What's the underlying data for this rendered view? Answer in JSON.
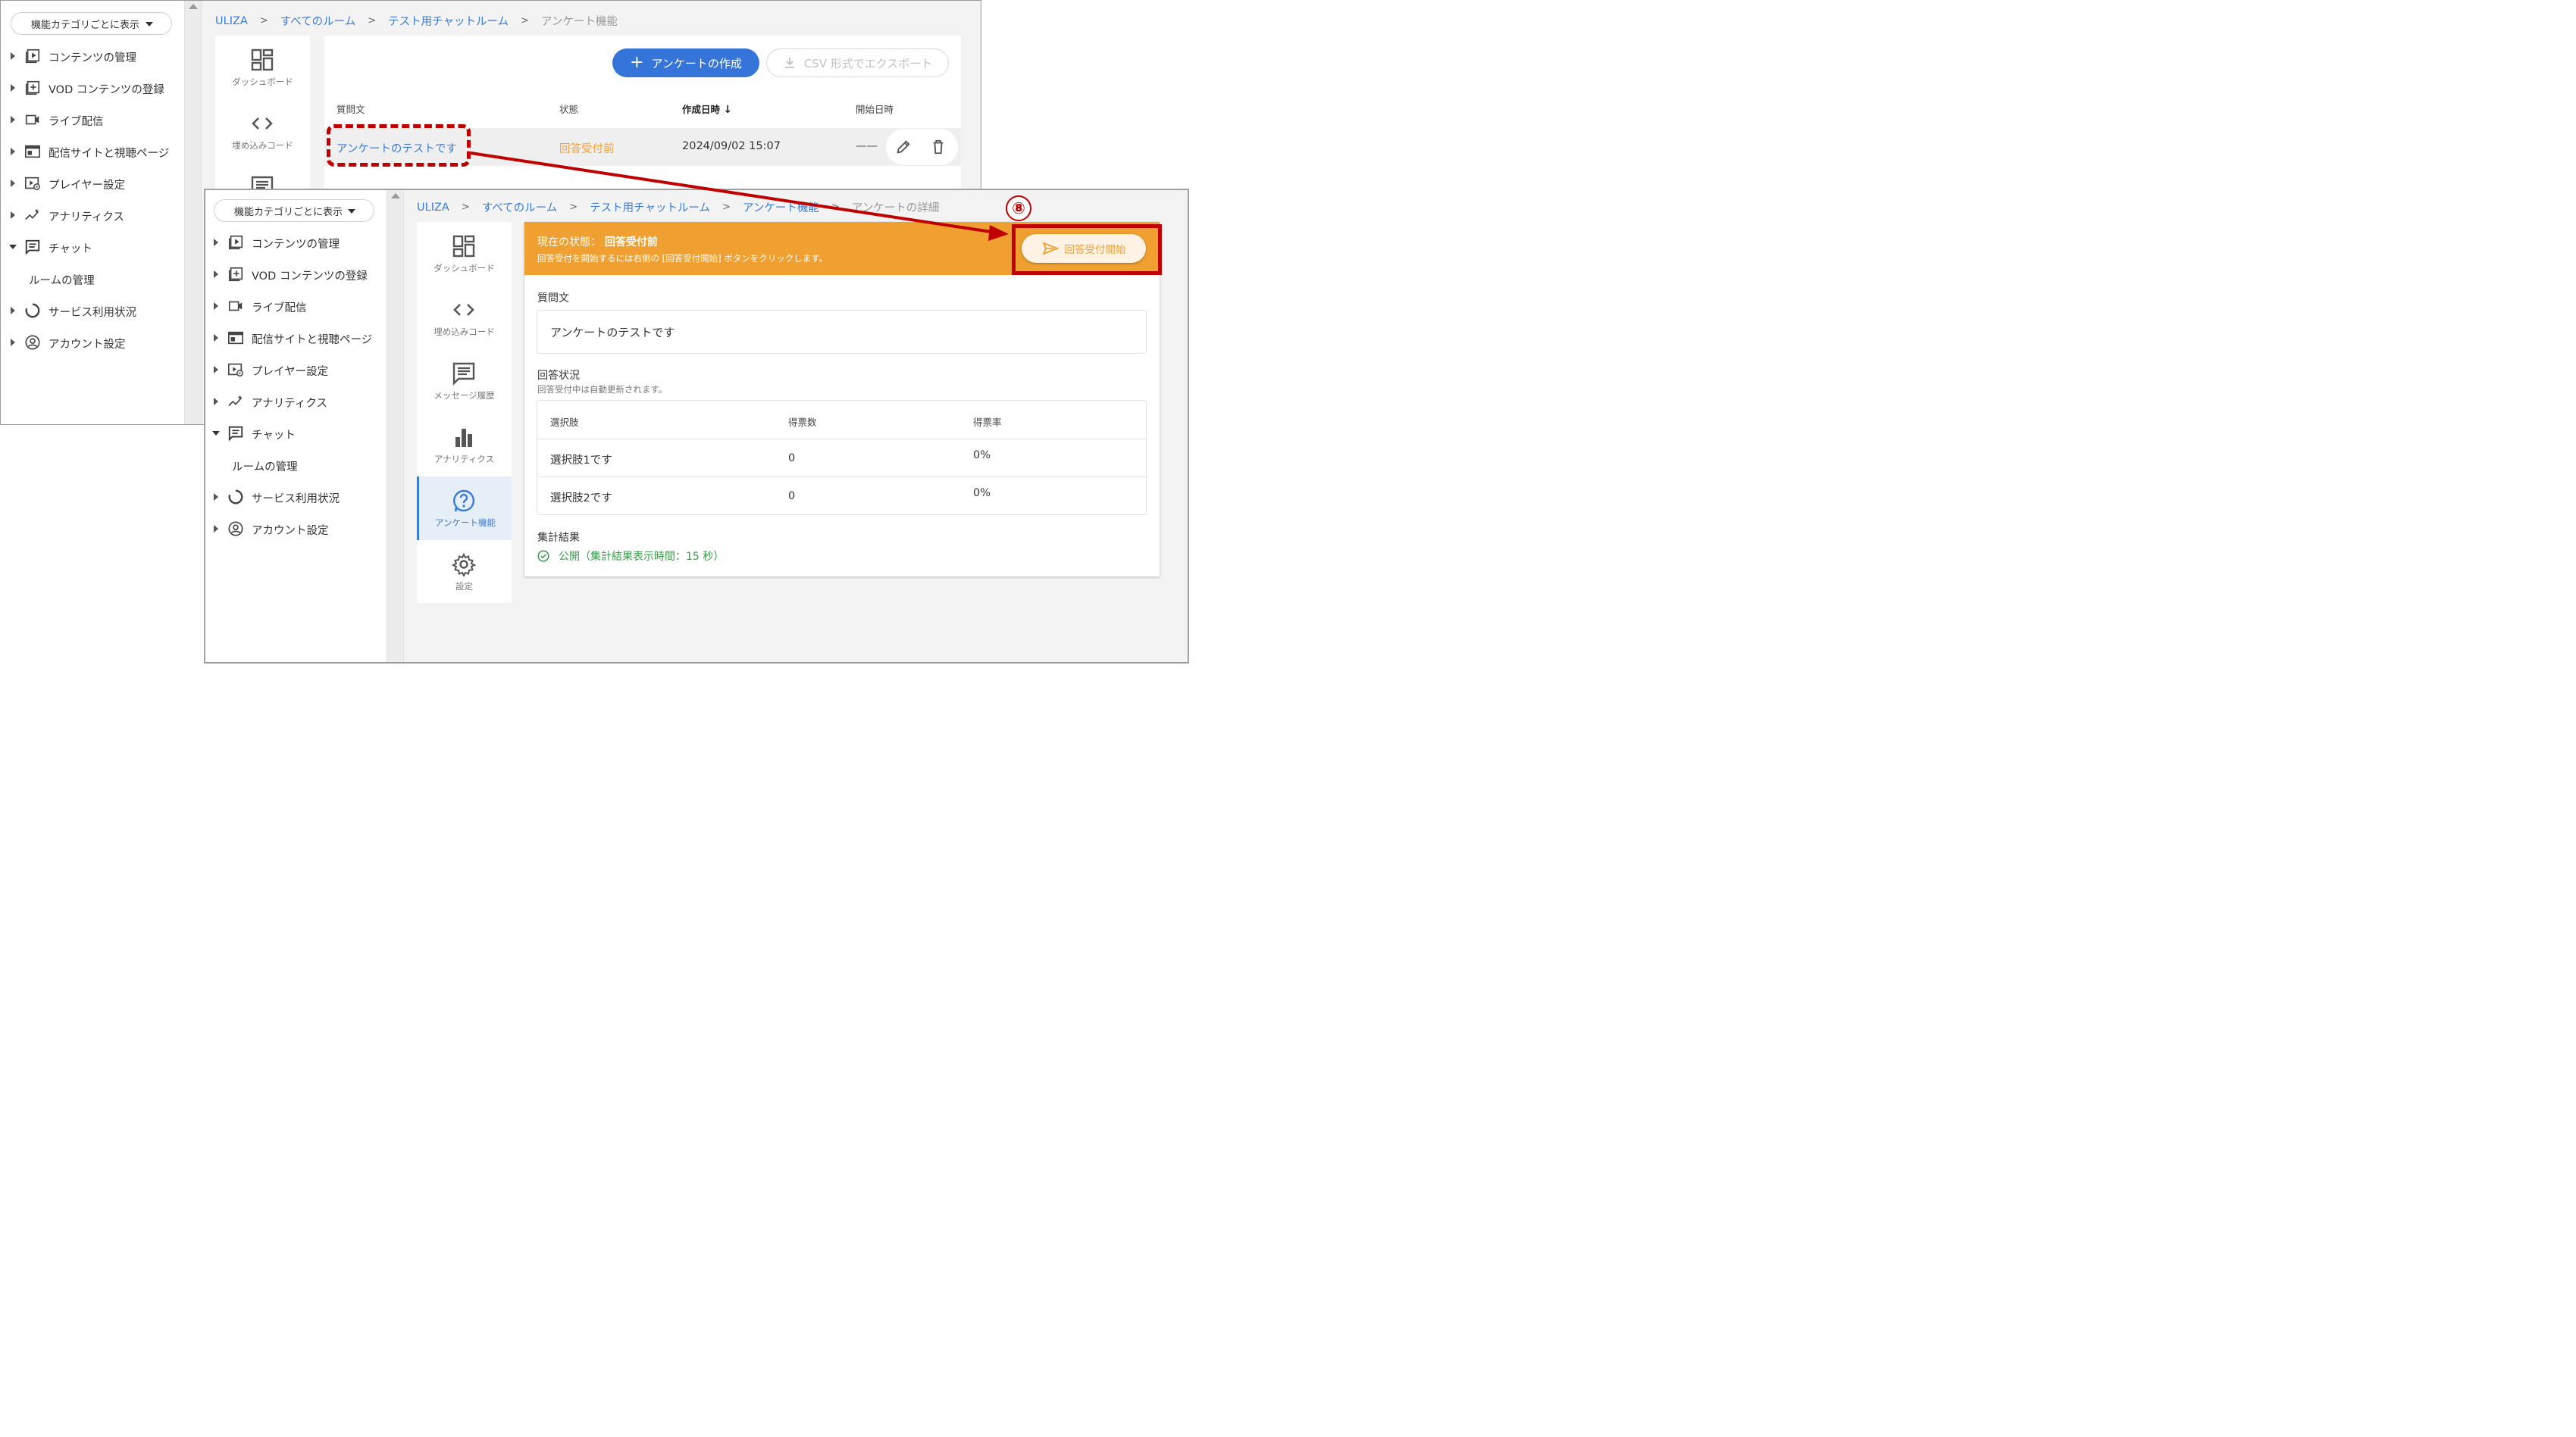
{
  "colors": {
    "link": "#3a7bd5",
    "primary_button": "#3574d8",
    "status_orange": "#f0a030",
    "annotation_red": "#c00000",
    "public_green": "#3a9a4a"
  },
  "sidebar": {
    "category_select": "機能カテゴリごとに表示",
    "items": [
      {
        "label": "コンテンツの管理",
        "icon": "play-box-icon"
      },
      {
        "label": "VOD コンテンツの登録",
        "icon": "add-box-icon"
      },
      {
        "label": "ライブ配信",
        "icon": "video-camera-icon"
      },
      {
        "label": "配信サイトと視聴ページ",
        "icon": "web-page-icon"
      },
      {
        "label": "プレイヤー設定",
        "icon": "player-settings-icon"
      },
      {
        "label": "アナリティクス",
        "icon": "analytics-icon"
      },
      {
        "label": "チャット",
        "icon": "chat-icon"
      },
      {
        "label": "ルームの管理",
        "icon": ""
      },
      {
        "label": "サービス利用状況",
        "icon": "usage-ring-icon"
      },
      {
        "label": "アカウント設定",
        "icon": "account-icon"
      }
    ]
  },
  "function_nav": [
    {
      "label": "ダッシュボード",
      "icon": "dashboard-icon"
    },
    {
      "label": "埋め込みコード",
      "icon": "code-icon"
    },
    {
      "label": "メッセージ履歴",
      "icon": "message-history-icon"
    },
    {
      "label": "アナリティクス",
      "icon": "bar-chart-icon"
    },
    {
      "label": "アンケート機能",
      "icon": "survey-question-icon"
    },
    {
      "label": "設定",
      "icon": "gear-icon"
    }
  ],
  "window1": {
    "breadcrumb": {
      "items": [
        "ULIZA",
        "すべてのルーム",
        "テスト用チャットルーム"
      ],
      "current": "アンケート機能",
      "separator": ">"
    },
    "create_button": "アンケートの作成",
    "export_button": "CSV 形式でエクスポート",
    "table": {
      "headers": [
        "質問文",
        "状態",
        "作成日時",
        "開始日時"
      ],
      "sort_indicator": "↓",
      "rows": [
        {
          "question": "アンケートのテストです",
          "status": "回答受付前",
          "created": "2024/09/02 15:07",
          "started": "——"
        }
      ]
    }
  },
  "window2": {
    "breadcrumb": {
      "items": [
        "ULIZA",
        "すべてのルーム",
        "テスト用チャットルーム",
        "アンケート機能"
      ],
      "current": "アンケートの詳細",
      "separator": ">"
    },
    "banner": {
      "state_prefix": "現在の状態：",
      "state": "回答受付前",
      "description": "回答受付を開始するには右側の [回答受付開始] ボタンをクリックします。",
      "start_button": "回答受付開始"
    },
    "question_label": "質問文",
    "question_text": "アンケートのテストです",
    "answers_label": "回答状況",
    "answers_note": "回答受付中は自動更新されます。",
    "answers_table": {
      "headers": [
        "選択肢",
        "得票数",
        "得票率"
      ],
      "rows": [
        {
          "choice": "選択肢1です",
          "votes": "0",
          "rate": "0%"
        },
        {
          "choice": "選択肢2です",
          "votes": "0",
          "rate": "0%"
        }
      ]
    },
    "results_label": "集計結果",
    "results_value": "公開（集計結果表示時間：15 秒）"
  },
  "annotation": {
    "step_number": "⑧"
  }
}
